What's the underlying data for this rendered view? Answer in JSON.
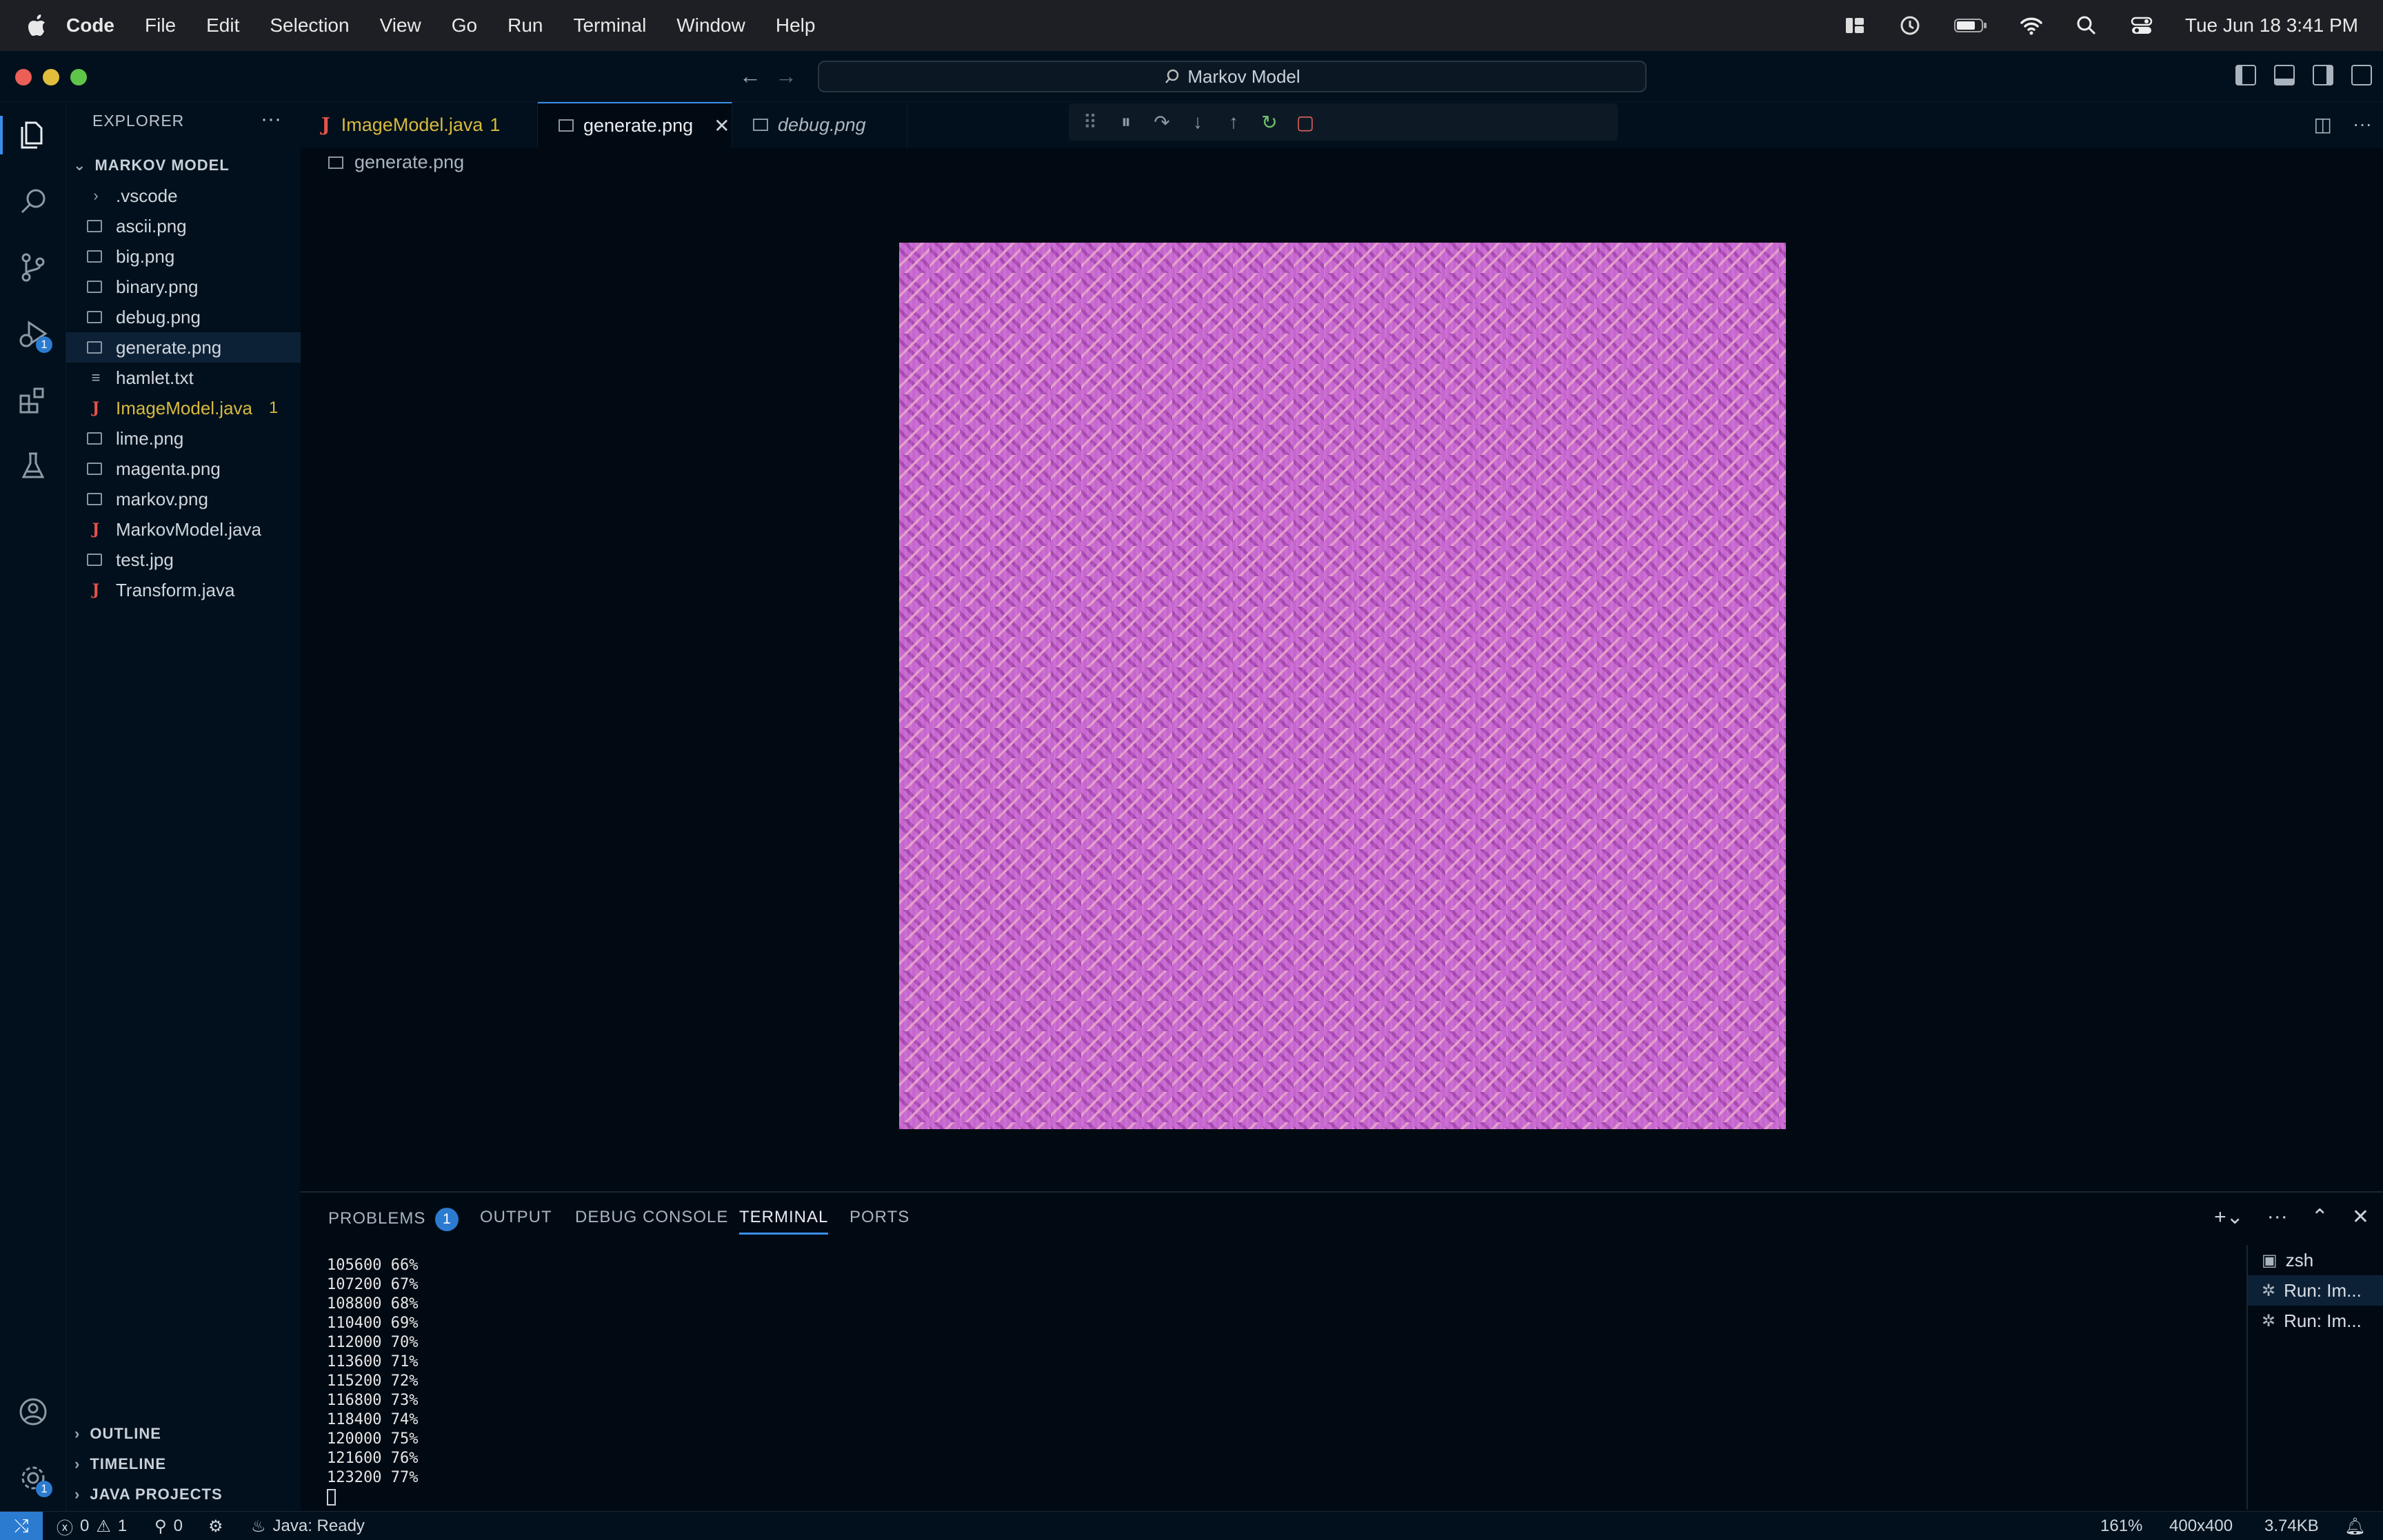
{
  "menubar": {
    "app": "Code",
    "items": [
      "File",
      "Edit",
      "Selection",
      "View",
      "Go",
      "Run",
      "Terminal",
      "Window",
      "Help"
    ],
    "clock": "Tue Jun 18  3:41 PM"
  },
  "titlebar": {
    "search": "Markov Model"
  },
  "activity": {
    "run_debug_badge": "1",
    "manage_badge": "1"
  },
  "explorer": {
    "header": "EXPLORER",
    "more": "···",
    "root": "MARKOV MODEL",
    "items": [
      {
        "name": ".vscode",
        "kind": "folder"
      },
      {
        "name": "ascii.png",
        "kind": "image"
      },
      {
        "name": "big.png",
        "kind": "image"
      },
      {
        "name": "binary.png",
        "kind": "image"
      },
      {
        "name": "debug.png",
        "kind": "image"
      },
      {
        "name": "generate.png",
        "kind": "image"
      },
      {
        "name": "hamlet.txt",
        "kind": "text"
      },
      {
        "name": "ImageModel.java",
        "kind": "java",
        "count": "1"
      },
      {
        "name": "lime.png",
        "kind": "image"
      },
      {
        "name": "magenta.png",
        "kind": "image"
      },
      {
        "name": "markov.png",
        "kind": "image"
      },
      {
        "name": "MarkovModel.java",
        "kind": "java"
      },
      {
        "name": "test.jpg",
        "kind": "image"
      },
      {
        "name": "Transform.java",
        "kind": "java"
      }
    ],
    "sections": [
      "OUTLINE",
      "TIMELINE",
      "JAVA PROJECTS"
    ]
  },
  "editor": {
    "tabs": [
      {
        "label": "ImageModel.java",
        "count": "1"
      },
      {
        "label": "generate.png"
      },
      {
        "label": "debug.png"
      }
    ],
    "breadcrumb": "generate.png"
  },
  "panel": {
    "tabs": [
      "PROBLEMS",
      "OUTPUT",
      "DEBUG CONSOLE",
      "TERMINAL",
      "PORTS"
    ],
    "problems_badge": "1",
    "terminal_lines": [
      "105600 66%",
      "107200 67%",
      "108800 68%",
      "110400 69%",
      "112000 70%",
      "113600 71%",
      "115200 72%",
      "116800 73%",
      "118400 74%",
      "120000 75%",
      "121600 76%",
      "123200 77%"
    ],
    "terminals": [
      "zsh",
      "Run: Im...",
      "Run: Im..."
    ]
  },
  "statusbar": {
    "errors": "0",
    "warnings": "1",
    "ports": "0",
    "java": "Java: Ready",
    "zoom": "161%",
    "dimensions": "400x400",
    "size": "3.74KB"
  },
  "colors": {
    "accent": "#3b8eea",
    "warning": "#d7ba3d",
    "java_icon": "#e4534a",
    "image_fill": "#c766cf"
  }
}
